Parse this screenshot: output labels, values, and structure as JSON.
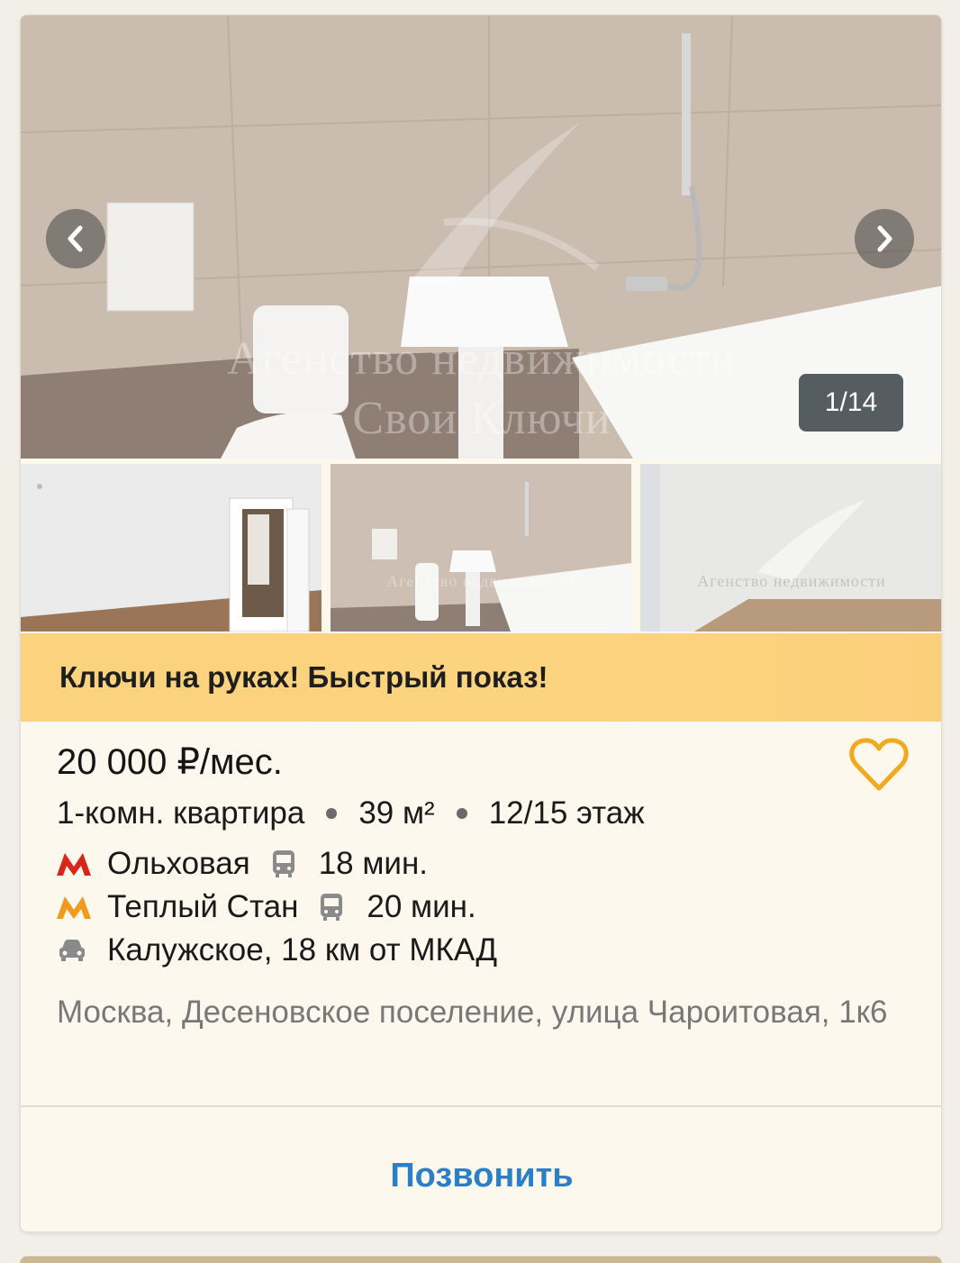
{
  "gallery": {
    "counter": "1/14",
    "watermark_line1": "Агенство недвижимости",
    "watermark_line2": "Свои Ключи",
    "prev_icon": "chevron-left-icon",
    "next_icon": "chevron-right-icon"
  },
  "banner": {
    "text": "Ключи на руках! Быстрый показ!"
  },
  "listing": {
    "price": "20 000 ₽/мес.",
    "rooms": "1-комн. квартира",
    "area": "39 м²",
    "floor": "12/15 этаж",
    "metro": [
      {
        "name": "Ольховая",
        "time": "18 мин.",
        "color": "#d8261d"
      },
      {
        "name": "Теплый Стан",
        "time": "20 мин.",
        "color": "#f39a1c"
      }
    ],
    "highway": "Калужское, 18 км от МКАД",
    "address": "Москва, Десеновское поселение, улица Чароитовая, 1к6"
  },
  "actions": {
    "call_label": "Позвонить",
    "favorite_icon": "heart-icon"
  },
  "colors": {
    "accent_blue": "#2b7ec8",
    "heart_orange": "#f2a91e",
    "banner_yellow": "#fcd37f"
  }
}
